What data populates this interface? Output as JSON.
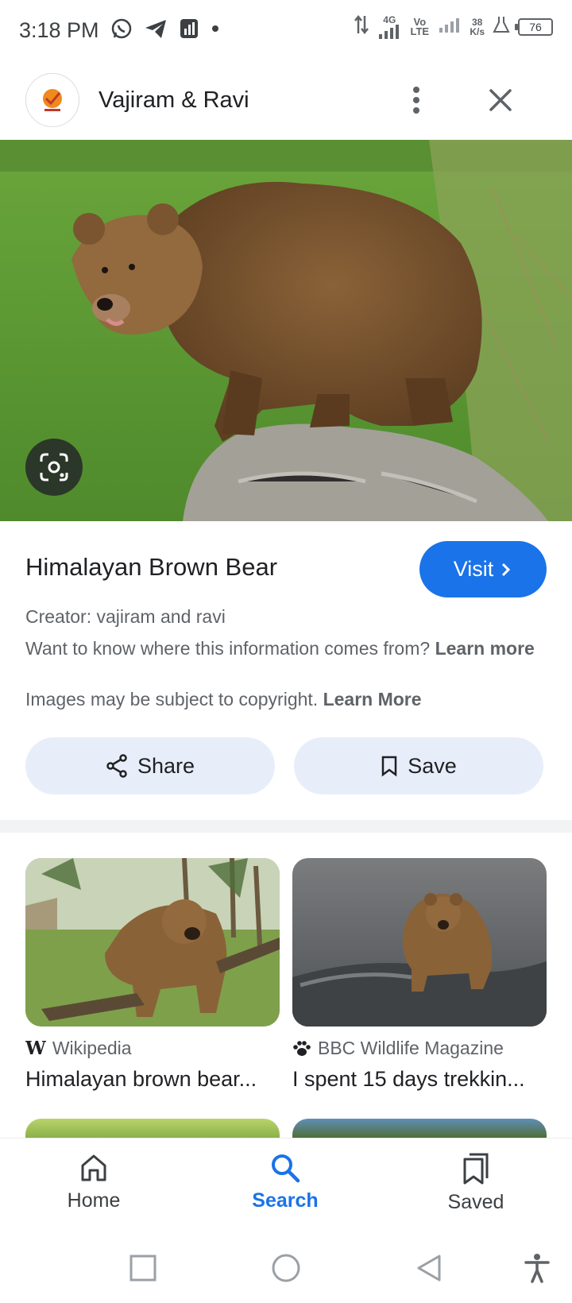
{
  "status_bar": {
    "time": "3:18 PM",
    "network_4g": "4G",
    "volte": "Vo LTE",
    "speed_value": "38",
    "speed_unit": "K/s",
    "battery": "76"
  },
  "header": {
    "site_name": "Vajiram & Ravi"
  },
  "result": {
    "title": "Himalayan Brown Bear",
    "visit_label": "Visit",
    "creator": "Creator: vajiram and ravi",
    "info_text": "Want to know where this information comes from?",
    "info_link": "Learn more",
    "copyright_text": "Images may be subject to copyright.",
    "copyright_link": "Learn More"
  },
  "actions": {
    "share_label": "Share",
    "save_label": "Save"
  },
  "related": [
    {
      "source": "Wikipedia",
      "source_icon": "wikipedia-icon",
      "title": "Himalayan brown bear..."
    },
    {
      "source": "BBC Wildlife Magazine",
      "source_icon": "paw-icon",
      "title": "I spent 15 days trekkin..."
    }
  ],
  "bottom_nav": {
    "items": [
      {
        "label": "Home",
        "icon": "home-icon"
      },
      {
        "label": "Search",
        "icon": "search-icon"
      },
      {
        "label": "Saved",
        "icon": "bookmarks-icon"
      }
    ],
    "active": "Search"
  },
  "colors": {
    "accent": "#1a73e8",
    "chip_bg": "#e8eef9",
    "text": "#202124",
    "muted": "#5f6368"
  }
}
